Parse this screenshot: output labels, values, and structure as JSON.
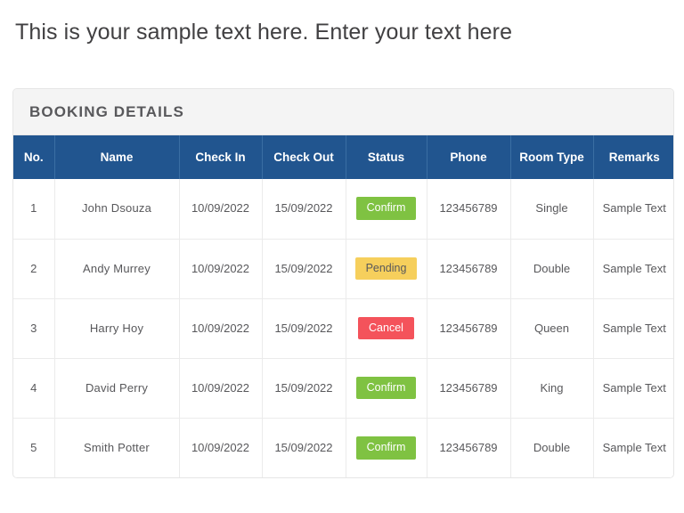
{
  "page": {
    "heading": "This is your sample text here. Enter your text here"
  },
  "card": {
    "title": "BOOKING DETAILS"
  },
  "table": {
    "columns": [
      {
        "key": "no",
        "label": "No."
      },
      {
        "key": "name",
        "label": "Name"
      },
      {
        "key": "check_in",
        "label": "Check In"
      },
      {
        "key": "check_out",
        "label": "Check Out"
      },
      {
        "key": "status",
        "label": "Status"
      },
      {
        "key": "phone",
        "label": "Phone"
      },
      {
        "key": "room_type",
        "label": "Room Type"
      },
      {
        "key": "remarks",
        "label": "Remarks"
      }
    ],
    "rows": [
      {
        "no": "1",
        "name": "John Dsouza",
        "check_in": "10/09/2022",
        "check_out": "15/09/2022",
        "status": "Confirm",
        "status_kind": "confirm",
        "phone": "123456789",
        "room_type": "Single",
        "remarks": "Sample Text"
      },
      {
        "no": "2",
        "name": "Andy Murrey",
        "check_in": "10/09/2022",
        "check_out": "15/09/2022",
        "status": "Pending",
        "status_kind": "pending",
        "phone": "123456789",
        "room_type": "Double",
        "remarks": "Sample Text"
      },
      {
        "no": "3",
        "name": "Harry  Hoy",
        "check_in": "10/09/2022",
        "check_out": "15/09/2022",
        "status": "Cancel",
        "status_kind": "cancel",
        "phone": "123456789",
        "room_type": "Queen",
        "remarks": "Sample Text"
      },
      {
        "no": "4",
        "name": "David Perry",
        "check_in": "10/09/2022",
        "check_out": "15/09/2022",
        "status": "Confirm",
        "status_kind": "confirm",
        "phone": "123456789",
        "room_type": "King",
        "remarks": "Sample Text"
      },
      {
        "no": "5",
        "name": "Smith Potter",
        "check_in": "10/09/2022",
        "check_out": "15/09/2022",
        "status": "Confirm",
        "status_kind": "confirm",
        "phone": "123456789",
        "room_type": "Double",
        "remarks": "Sample Text"
      }
    ]
  },
  "colors": {
    "header_blue": "#21558F",
    "status_confirm": "#7FC242",
    "status_pending": "#F6CF5C",
    "status_cancel": "#F4535B",
    "title_bar": "#f4f4f4",
    "text": "#58585b"
  }
}
